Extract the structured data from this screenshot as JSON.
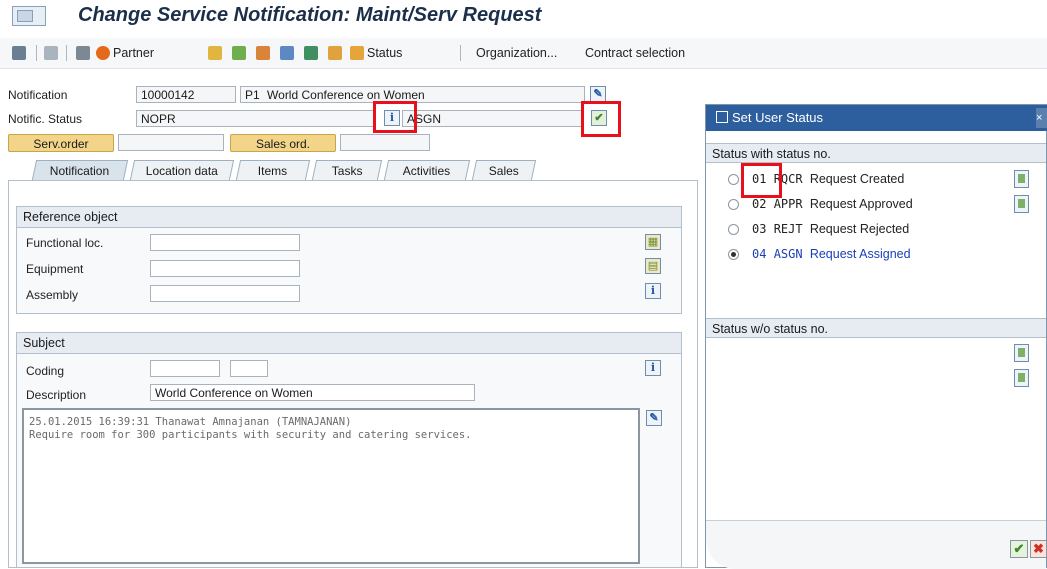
{
  "window": {
    "title": "Change Service Notification: Maint/Serv Request"
  },
  "toolbar": {
    "partner": "Partner",
    "status": "Status",
    "organization": "Organization...",
    "contract_selection": "Contract selection"
  },
  "header": {
    "notification_label": "Notification",
    "notification_number": "10000142",
    "notification_type": "P1",
    "notification_desc": "World Conference on Women",
    "status_label": "Notific. Status",
    "system_status": "NOPR",
    "user_status": "ASGN",
    "serv_order_button": "Serv.order",
    "sales_ord_button": "Sales ord."
  },
  "tabs": [
    "Notification",
    "Location data",
    "Items",
    "Tasks",
    "Activities",
    "Sales"
  ],
  "reference_object": {
    "title": "Reference object",
    "functional_loc": "Functional loc.",
    "equipment": "Equipment",
    "assembly": "Assembly"
  },
  "subject": {
    "title": "Subject",
    "coding": "Coding",
    "description_label": "Description",
    "description_value": "World Conference on Women",
    "long_text_line1": "25.01.2015 16:39:31 Thanawat Amnajanan (TAMNAJANAN)",
    "long_text_line2": "Require room for 300 participants with security and catering services."
  },
  "dialog": {
    "title": "Set User Status",
    "with_no_header": "Status with status no.",
    "without_no_header": "Status w/o status no.",
    "statuses": [
      {
        "no": "01",
        "code": "RQCR",
        "text": "Request Created",
        "selected": false
      },
      {
        "no": "02",
        "code": "APPR",
        "text": "Request Approved",
        "selected": false
      },
      {
        "no": "03",
        "code": "REJT",
        "text": "Request Rejected",
        "selected": false
      },
      {
        "no": "04",
        "code": "ASGN",
        "text": "Request Assigned",
        "selected": true
      }
    ]
  },
  "colors": {
    "dialog_title_bg": "#2d5f9e",
    "highlight_red": "#e8101a",
    "button_yellow": "#f3d58a",
    "selected_status_text": "#1a3fb8"
  }
}
